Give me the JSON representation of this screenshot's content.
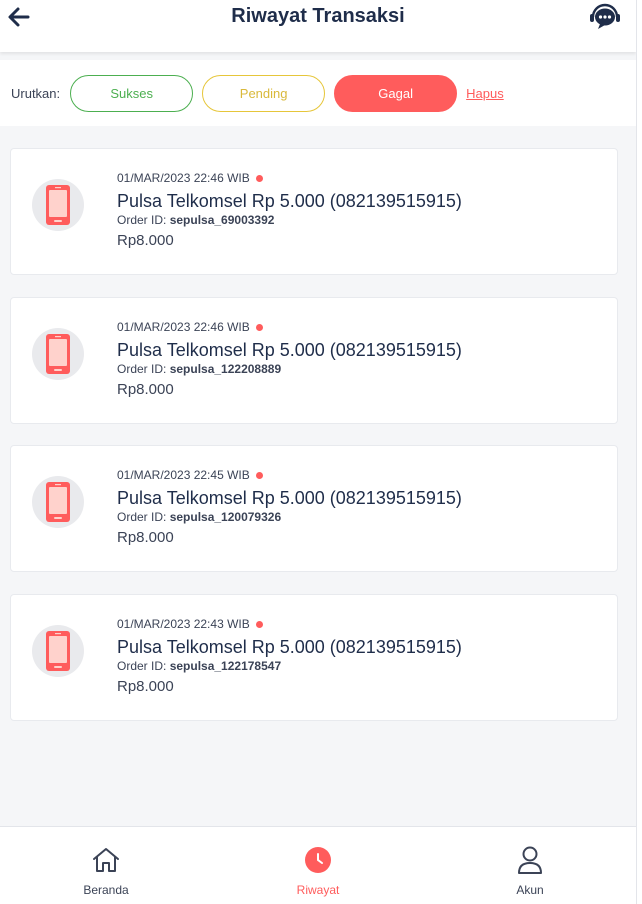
{
  "header": {
    "title": "Riwayat Transaksi"
  },
  "filter": {
    "label": "Urutkan:",
    "chips": [
      "Sukses",
      "Pending",
      "Gagal"
    ],
    "active": "Gagal",
    "clear_label": "Hapus"
  },
  "transactions": [
    {
      "date": "01/MAR/2023 22:46 WIB",
      "title": "Pulsa Telkomsel Rp 5.000 (082139515915)",
      "order_label": "Order ID:",
      "order_id": "sepulsa_69003392",
      "price": "Rp8.000"
    },
    {
      "date": "01/MAR/2023 22:46 WIB",
      "title": "Pulsa Telkomsel Rp 5.000 (082139515915)",
      "order_label": "Order ID:",
      "order_id": "sepulsa_122208889",
      "price": "Rp8.000"
    },
    {
      "date": "01/MAR/2023 22:45 WIB",
      "title": "Pulsa Telkomsel Rp 5.000 (082139515915)",
      "order_label": "Order ID:",
      "order_id": "sepulsa_120079326",
      "price": "Rp8.000"
    },
    {
      "date": "01/MAR/2023 22:43 WIB",
      "title": "Pulsa Telkomsel Rp 5.000 (082139515915)",
      "order_label": "Order ID:",
      "order_id": "sepulsa_122178547",
      "price": "Rp8.000"
    }
  ],
  "nav": {
    "items": [
      {
        "label": "Beranda",
        "icon": "home-icon"
      },
      {
        "label": "Riwayat",
        "icon": "clock-icon"
      },
      {
        "label": "Akun",
        "icon": "user-icon"
      }
    ],
    "active": "Riwayat"
  },
  "colors": {
    "accent": "#ff5c5c",
    "success": "#4caf50",
    "pending": "#e6c63a",
    "text": "#1f2d4a"
  }
}
